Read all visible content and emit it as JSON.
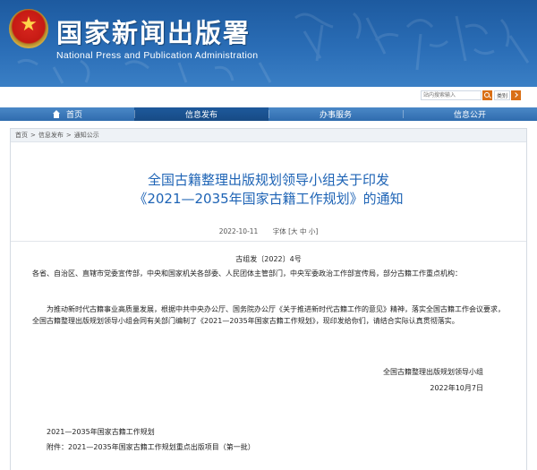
{
  "header": {
    "title": "国家新闻出版署",
    "subtitle": "National Press and Publication Administration",
    "emblem_icon": "national-emblem-icon"
  },
  "search": {
    "placeholder": "站内搜索输入",
    "category": "类别",
    "search_icon": "search-icon",
    "go_icon": "chevron-icon",
    "accent_color": "#d96f16"
  },
  "nav": {
    "items": [
      {
        "label": "首页",
        "icon": "home-icon"
      },
      {
        "label": "信息发布"
      },
      {
        "label": "办事服务"
      },
      {
        "label": "信息公开"
      }
    ],
    "active_index": 1
  },
  "breadcrumb": {
    "items": [
      "首页",
      "信息发布",
      "通知公示"
    ],
    "separator": ">"
  },
  "article": {
    "title_line1": "全国古籍整理出版规划领导小组关于印发",
    "title_line2": "《2021—2035年国家古籍工作规划》的通知",
    "date": "2022-10-11",
    "font_size_label": "字体",
    "font_sizes": [
      "[大",
      "中",
      "小]"
    ],
    "doc_number": "古组发〔2022〕4号",
    "salutation": "各省、自治区、直辖市党委宣传部，中央和国家机关各部委、人民团体主管部门，中央军委政治工作部宣传局，部分古籍工作重点机构：",
    "body": "为推动新时代古籍事业高质量发展，根据中共中央办公厅、国务院办公厅《关于推进新时代古籍工作的意见》精神，落实全国古籍工作会议要求，全国古籍整理出版规划领导小组会同有关部门编制了《2021—2035年国家古籍工作规划》，现印发给你们，请结合实际认真贯彻落实。",
    "signatory": "全国古籍整理出版规划领导小组",
    "sign_date": "2022年10月7日",
    "attachment_1": "2021—2035年国家古籍工作规划",
    "attachment_2": "附件：2021—2035年国家古籍工作规划重点出版项目（第一批）"
  },
  "colors": {
    "banner_blue": "#2a6db6",
    "nav_blue": "#2f6cae",
    "title_blue": "#1d63b5"
  }
}
